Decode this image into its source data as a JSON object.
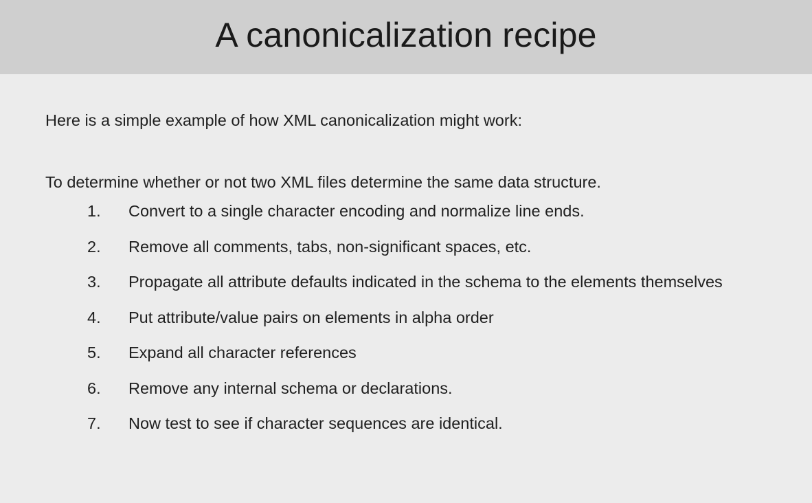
{
  "slide": {
    "title": "A canonicalization recipe",
    "intro": "Here is a simple example of how XML canonicalization might work:",
    "lead": "To determine whether or not two XML files determine the same data structure.",
    "steps": [
      {
        "num": "1.",
        "text": "Convert to a single character encoding and normalize line ends."
      },
      {
        "num": "2.",
        "text": "Remove all comments, tabs, non-significant spaces, etc."
      },
      {
        "num": "3.",
        "text": "Propagate all attribute defaults indicated in the schema to the elements themselves"
      },
      {
        "num": "4.",
        "text": "Put attribute/value pairs on elements in alpha order"
      },
      {
        "num": "5.",
        "text": "Expand all character references"
      },
      {
        "num": "6.",
        "text": "Remove any internal schema or declarations."
      },
      {
        "num": "7.",
        "text": "Now test to see if character sequences are identical."
      }
    ]
  },
  "colors": {
    "title_bar": "#cfcfcf",
    "background": "#ececec",
    "text": "#1f1f1f"
  }
}
